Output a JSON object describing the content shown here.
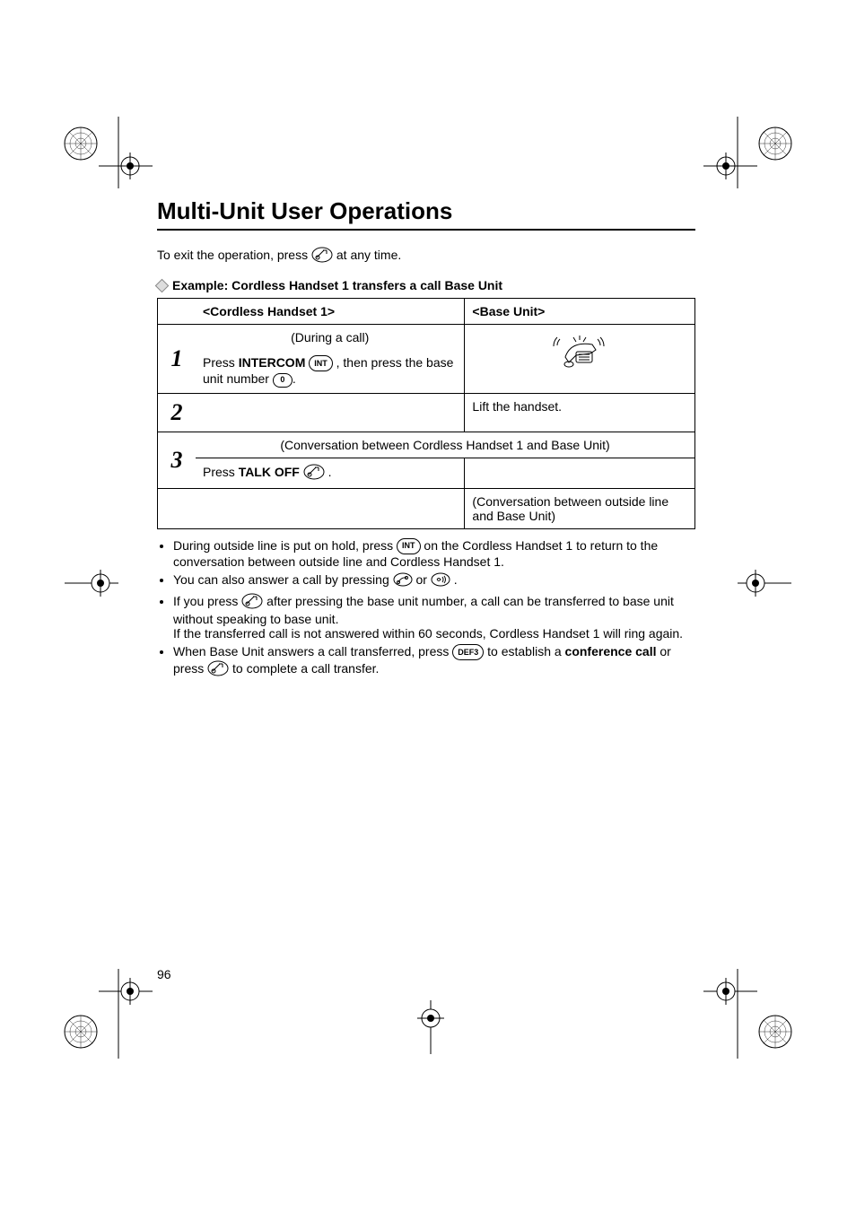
{
  "title": "Multi-Unit User Operations",
  "exit_prefix": "To exit the operation, press ",
  "exit_suffix": " at any time.",
  "example_heading": "Example: Cordless Handset 1 transfers a call Base Unit",
  "table": {
    "header_left": "<Cordless Handset 1>",
    "header_right": "<Base Unit>",
    "during_call": "(During a call)",
    "step1_a": "Press ",
    "step1_intercom": "INTERCOM",
    "step1_b": " , then press the base unit number ",
    "step1_c": ".",
    "step2_right": "Lift the handset.",
    "conversation": "(Conversation between Cordless Handset 1 and Base Unit)",
    "step3_a": "Press ",
    "step3_talkoff": "TALK OFF",
    "step3_b": " .",
    "outside_conv": "(Conversation between outside line and Base Unit)",
    "num1": "1",
    "num2": "2",
    "num3": "3",
    "int_key": "INT",
    "zero_key": "0",
    "def3_key": "DEF3"
  },
  "notes": {
    "n1a": "During outside line is put on hold, press ",
    "n1b": " on the Cordless Handset 1 to return to the conversation between outside line and Cordless Handset 1.",
    "n2a": "You can also answer a call by pressing ",
    "n2b": " or ",
    "n2c": " .",
    "n3a": "If you press ",
    "n3b": " after pressing the base unit number, a call can be transferred to  base unit without speaking to base unit.",
    "n3c": "If the transferred call is not answered within 60 seconds, Cordless Handset 1 will ring again.",
    "n4a": "When Base Unit answers a call transferred, press ",
    "n4b": " to establish a ",
    "n4_bold": "conference call",
    "n4c": " or press ",
    "n4d": " to complete a call transfer."
  },
  "page_number": "96"
}
